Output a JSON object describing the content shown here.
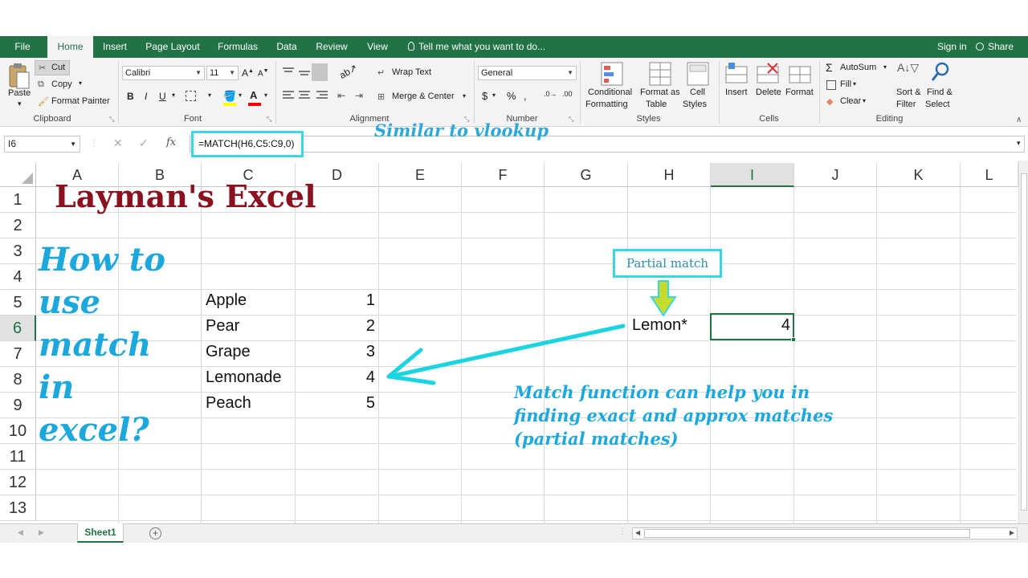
{
  "tabs": {
    "file": "File",
    "home": "Home",
    "insert": "Insert",
    "page_layout": "Page Layout",
    "formulas": "Formulas",
    "data": "Data",
    "review": "Review",
    "view": "View",
    "tell_me": "Tell me what you want to do...",
    "sign_in": "Sign in",
    "share": "Share"
  },
  "ribbon": {
    "clipboard": {
      "paste": "Paste",
      "cut": "Cut",
      "copy": "Copy",
      "format_painter": "Format Painter",
      "label": "Clipboard"
    },
    "font": {
      "name": "Calibri",
      "size": "11",
      "label": "Font"
    },
    "alignment": {
      "wrap_text": "Wrap Text",
      "merge_center": "Merge & Center",
      "label": "Alignment"
    },
    "number": {
      "format": "General",
      "label": "Number"
    },
    "styles": {
      "conditional_1": "Conditional",
      "conditional_2": "Formatting",
      "format_as_1": "Format as",
      "format_as_2": "Table",
      "cell_1": "Cell",
      "cell_2": "Styles",
      "label": "Styles"
    },
    "cells": {
      "insert": "Insert",
      "delete": "Delete",
      "format": "Format",
      "label": "Cells"
    },
    "editing": {
      "autosum": "AutoSum",
      "fill": "Fill",
      "clear": "Clear",
      "sort_1": "Sort &",
      "sort_2": "Filter",
      "find_1": "Find &",
      "find_2": "Select",
      "label": "Editing"
    }
  },
  "formula_bar": {
    "name_box": "I6",
    "formula": "=MATCH(H6,C5:C9,0)",
    "annotation": "Similar to vlookup"
  },
  "columns": [
    "A",
    "B",
    "C",
    "D",
    "E",
    "F",
    "G",
    "H",
    "I",
    "J",
    "K",
    "L"
  ],
  "rows": [
    "1",
    "2",
    "3",
    "4",
    "5",
    "6",
    "7",
    "8",
    "9",
    "10",
    "11",
    "12",
    "13"
  ],
  "cells": {
    "fruits": [
      "Apple",
      "Pear",
      "Grape",
      "Lemonade",
      "Peach"
    ],
    "numbers": [
      "1",
      "2",
      "3",
      "4",
      "5"
    ],
    "lookup": "Lemon*",
    "result": "4"
  },
  "overlays": {
    "title": "Layman's Excel",
    "howto": [
      "How to",
      "use",
      "match",
      "in",
      "excel?"
    ],
    "partial_match": "Partial match",
    "description": [
      "Match function can help you in",
      "finding exact and approx matches",
      "(partial matches)"
    ]
  },
  "sheet": {
    "tab": "Sheet1"
  },
  "colors": {
    "excel_green": "#217346",
    "annotation_blue": "#1ca8dc",
    "title_red": "#8b1020",
    "highlight_cyan": "#3ad6e6"
  }
}
